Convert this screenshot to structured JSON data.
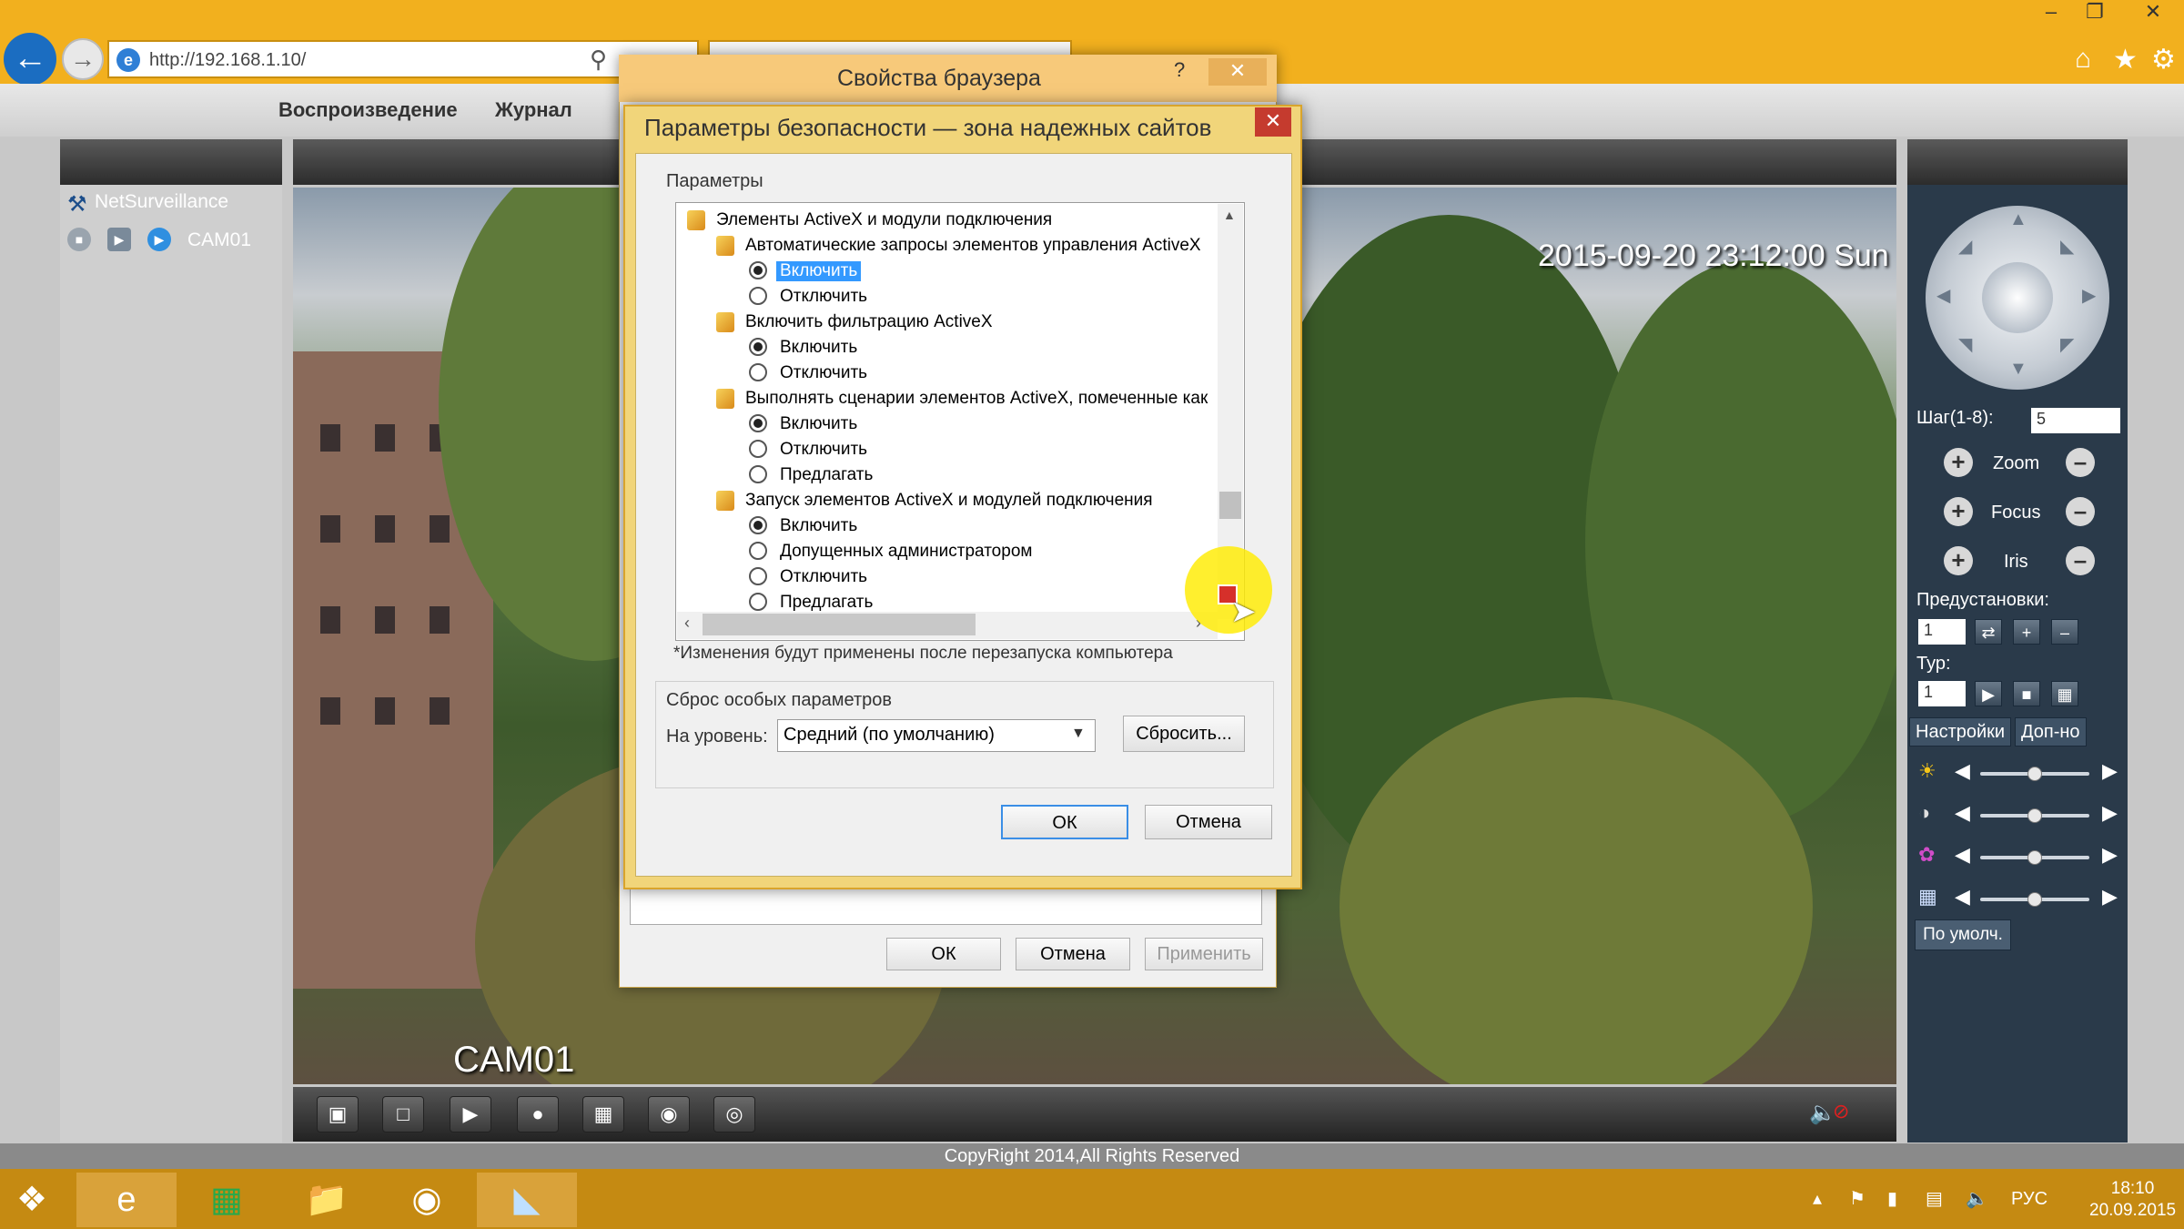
{
  "browser": {
    "url": "http://192.168.1.10/",
    "tab2_label": ""
  },
  "page_menu": {
    "items": [
      "Воспроизведение",
      "Журнал"
    ]
  },
  "left_panel": {
    "title": "NetSurveillance",
    "camera": "CAM01"
  },
  "video": {
    "timestamp": "2015-09-20 23:12:00 Sun",
    "camera_label": "CAM01"
  },
  "right_panel": {
    "step_label": "Шаг(1-8):",
    "step_value": "5",
    "zoom_label": "Zoom",
    "focus_label": "Focus",
    "iris_label": "Iris",
    "presets_label": "Предустановки:",
    "preset_value": "1",
    "tour_label": "Тур:",
    "tour_value": "1",
    "tab_settings": "Настройки",
    "tab_extra": "Доп-но",
    "defaults_button": "По умолч."
  },
  "copyright": "CopyRight 2014,All Rights Reserved",
  "browser_properties": {
    "title": "Свойства браузера",
    "help": "?",
    "ok": "ОК",
    "cancel": "Отмена",
    "apply": "Применить"
  },
  "security_dialog": {
    "title": "Параметры безопасности — зона надежных сайтов",
    "params_label": "Параметры",
    "tree": {
      "root": "Элементы ActiveX и модули подключения",
      "g1": "Автоматические запросы элементов управления ActiveX",
      "g1_o1": "Включить",
      "g1_o2": "Отключить",
      "g2": "Включить фильтрацию ActiveX",
      "g2_o1": "Включить",
      "g2_o2": "Отключить",
      "g3": "Выполнять сценарии элементов ActiveX, помеченные как",
      "g3_o1": "Включить",
      "g3_o2": "Отключить",
      "g3_o3": "Предлагать",
      "g4": "Запуск элементов ActiveX и модулей подключения",
      "g4_o1": "Включить",
      "g4_o2": "Допущенных администратором",
      "g4_o3": "Отключить",
      "g4_o4": "Предлагать"
    },
    "note": "*Изменения будут применены после перезапуска компьютера",
    "reset_group_label": "Сброс особых параметров",
    "level_label": "На уровень:",
    "level_value": "Средний (по умолчанию)",
    "reset_button": "Сбросить...",
    "ok": "ОК",
    "cancel": "Отмена"
  },
  "taskbar": {
    "lang": "РУС",
    "time": "18:10",
    "date": "20.09.2015"
  }
}
